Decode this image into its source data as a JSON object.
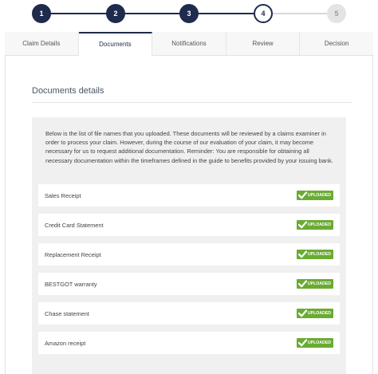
{
  "stepper": {
    "steps": [
      {
        "label": "1",
        "state": "done"
      },
      {
        "label": "2",
        "state": "done"
      },
      {
        "label": "3",
        "state": "done"
      },
      {
        "label": "4",
        "state": "current"
      },
      {
        "label": "5",
        "state": "todo"
      }
    ],
    "colors": {
      "done": "#1f2b4d",
      "todo": "#e4e4e4"
    }
  },
  "tabs": [
    {
      "label": "Claim Details"
    },
    {
      "label": "Documents",
      "active": true
    },
    {
      "label": "Notifications"
    },
    {
      "label": "Review"
    },
    {
      "label": "Decision"
    }
  ],
  "documents": {
    "title": "Documents details",
    "intro": "Below is the list of file names that you uploaded. These documents will be reviewed by a claims examiner in order to process your claim. However, during the course of our evaluation of your claim, it may become necessary for us to request additional documentation. Reminder: You are responsible for obtaining all necessary documentation within the timeframes defined in the guide to benefits provided by your issuing bank.",
    "items": [
      {
        "name": "Sales Receipt",
        "status": "UPLOADED"
      },
      {
        "name": "Credit Card Statement",
        "status": "UPLOADED"
      },
      {
        "name": "Replacement Receipt",
        "status": "UPLOADED"
      },
      {
        "name": "BESTGOT warranty",
        "status": "UPLOADED"
      },
      {
        "name": "Chase statement",
        "status": "UPLOADED"
      },
      {
        "name": "Amazon receipt",
        "status": "UPLOADED"
      }
    ],
    "status_color": "#6aab33"
  }
}
